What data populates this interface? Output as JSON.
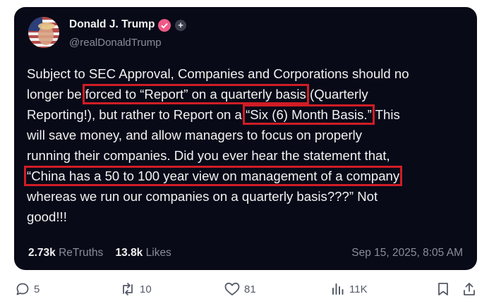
{
  "post": {
    "author": {
      "display_name": "Donald J. Trump",
      "handle": "@realDonaldTrump",
      "avatar_icon": "flag-avatar-icon",
      "verified_icon": "verified-badge-icon",
      "plus_badge": "+"
    },
    "body_lines": [
      [
        "Subject to SEC Approval, Companies and Corporations should no"
      ],
      [
        "longer be ",
        "forced to “Report” on a quarterly basis",
        " (Quarterly"
      ],
      [
        "Reporting!), but rather to Report on a ",
        "“Six (6) Month Basis.”",
        " This"
      ],
      [
        "will save money, and allow managers to focus on properly"
      ],
      [
        "running their companies. Did you ever hear the statement that,"
      ],
      [
        "“China has a 50 to 100 year view on management of a company"
      ],
      [
        "whereas we run our companies on a quarterly basis???” Not"
      ],
      [
        "good!!!"
      ]
    ],
    "highlights": {
      "color": "#d01d25",
      "phrases": [
        "forced to “Report” on a quarterly basis",
        "“Six (6) Month Basis.”",
        "“China has a 50 to 100 year view on management of a company"
      ]
    },
    "stats": {
      "retruths_count": "2.73k",
      "retruths_label": "ReTruths",
      "likes_count": "13.8k",
      "likes_label": "Likes"
    },
    "timestamp": "Sep 15, 2025, 8:05 AM"
  },
  "actions": {
    "reply": {
      "icon": "reply-icon",
      "count": "5"
    },
    "retruth": {
      "icon": "retruth-icon",
      "count": "10"
    },
    "like": {
      "icon": "heart-icon",
      "count": "81"
    },
    "views": {
      "icon": "views-icon",
      "count": "11K"
    },
    "bookmark": {
      "icon": "bookmark-icon"
    },
    "share": {
      "icon": "share-icon"
    }
  },
  "colors": {
    "card_background": "#080a18",
    "verified_badge": "#ef5a87",
    "text_primary": "#f2f2f2",
    "text_secondary": "#8b8d99"
  }
}
